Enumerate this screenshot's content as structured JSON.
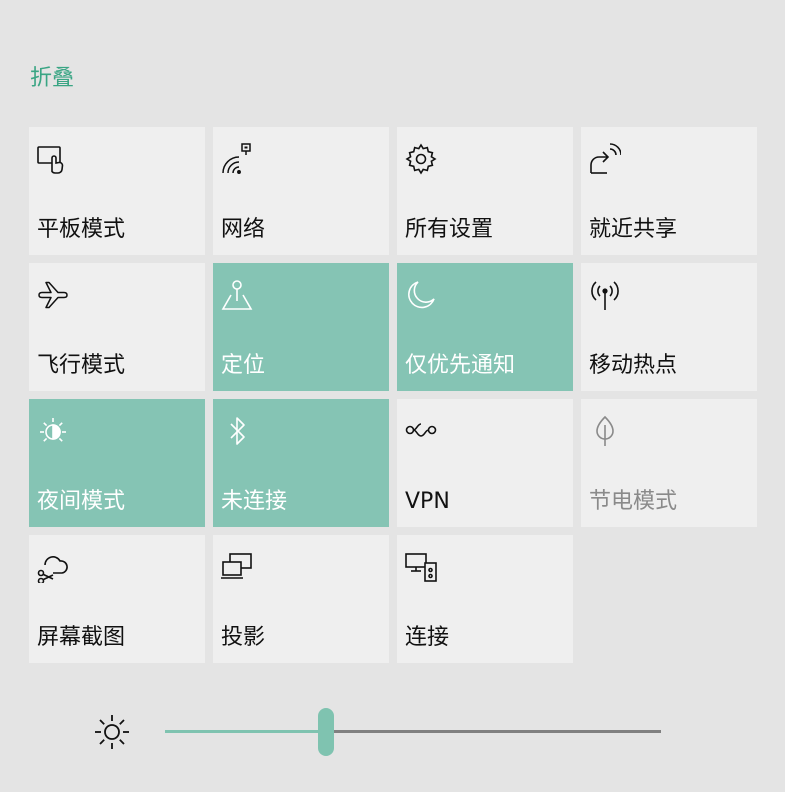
{
  "header": {
    "collapse_label": "折叠"
  },
  "colors": {
    "accent": "#85c4b4",
    "accent_text": "#3aa584",
    "tile": "#efefef",
    "background": "#e4e4e4"
  },
  "tiles": [
    {
      "label": "平板模式",
      "icon": "tablet-mode-icon",
      "state": "off"
    },
    {
      "label": "网络",
      "icon": "network-icon",
      "state": "off"
    },
    {
      "label": "所有设置",
      "icon": "settings-gear-icon",
      "state": "off"
    },
    {
      "label": "就近共享",
      "icon": "nearby-share-icon",
      "state": "off"
    },
    {
      "label": "飞行模式",
      "icon": "airplane-icon",
      "state": "off"
    },
    {
      "label": "定位",
      "icon": "location-icon",
      "state": "on"
    },
    {
      "label": "仅优先通知",
      "icon": "moon-icon",
      "state": "on"
    },
    {
      "label": "移动热点",
      "icon": "hotspot-icon",
      "state": "off"
    },
    {
      "label": "夜间模式",
      "icon": "night-light-icon",
      "state": "on"
    },
    {
      "label": "未连接",
      "icon": "bluetooth-icon",
      "state": "on"
    },
    {
      "label": "VPN",
      "icon": "vpn-icon",
      "state": "off"
    },
    {
      "label": "节电模式",
      "icon": "battery-saver-icon",
      "state": "disabled"
    },
    {
      "label": "屏幕截图",
      "icon": "screen-snip-icon",
      "state": "off"
    },
    {
      "label": "投影",
      "icon": "project-icon",
      "state": "off"
    },
    {
      "label": "连接",
      "icon": "connect-icon",
      "state": "off"
    }
  ],
  "brightness": {
    "icon": "brightness-sun-icon",
    "level_percent": 32
  }
}
